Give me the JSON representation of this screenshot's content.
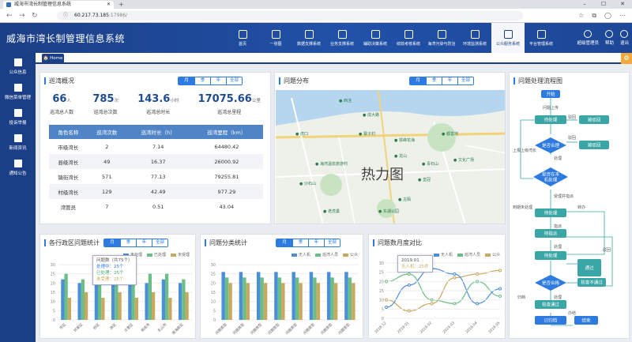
{
  "browser": {
    "tab_title": "威海市湾长制管理信息系统",
    "url_host": "60.217.73.185",
    "url_rest": ":17986/"
  },
  "app": {
    "title": "威海市湾长制管理信息系统"
  },
  "topnav": [
    {
      "label": "首页",
      "icon": "home-icon"
    },
    {
      "label": "一张图",
      "icon": "map-icon"
    },
    {
      "label": "数据支撑系统",
      "icon": "layers-icon"
    },
    {
      "label": "业务支撑系统",
      "icon": "database-icon"
    },
    {
      "label": "辅助决策系统",
      "icon": "bar-chart-icon"
    },
    {
      "label": "绩效考核系统",
      "icon": "medal-icon"
    },
    {
      "label": "海湾污染与防治",
      "icon": "shield-icon"
    },
    {
      "label": "环境监测系统",
      "icon": "gear-icon"
    },
    {
      "label": "公众服务系统",
      "icon": "car-icon",
      "active": true
    },
    {
      "label": "平台管理系统",
      "icon": "monitor-icon"
    }
  ],
  "user": {
    "name": "超级管理员",
    "help": "帮助",
    "logout": "退出"
  },
  "sidebar": [
    {
      "label": "公众信息"
    },
    {
      "label": "微信菜单管理"
    },
    {
      "label": "投诉举报"
    },
    {
      "label": "新闻资讯"
    },
    {
      "label": "通知公告"
    }
  ],
  "tabs": {
    "home": "Home"
  },
  "periods": [
    "月",
    "季",
    "年",
    "全部"
  ],
  "overview": {
    "title": "巡湾概况",
    "stats": [
      {
        "value": "66",
        "unit": "人",
        "label": "巡湾总人数"
      },
      {
        "value": "785",
        "unit": "次",
        "label": "巡湾总次数"
      },
      {
        "value": "143.6",
        "unit": "小时",
        "label": "巡湾总时长"
      },
      {
        "value": "17075.66",
        "unit": "公里",
        "label": "巡湾总里程"
      }
    ],
    "headers": [
      "角色名称",
      "巡湾次数",
      "巡湾时长（h）",
      "巡湾里程（km）"
    ],
    "rows": [
      [
        "市级湾长",
        "2",
        "7.14",
        "64480.42"
      ],
      [
        "县级湾长",
        "49",
        "16.37",
        "26000.92"
      ],
      [
        "镇街湾长",
        "571",
        "77.13",
        "79255.81"
      ],
      [
        "村级湾长",
        "129",
        "42.49",
        "977.29"
      ],
      [
        "湾管员",
        "7",
        "0.51",
        "43.04"
      ]
    ]
  },
  "map": {
    "title": "问题分布",
    "heat_label": "热力图",
    "labels": [
      "成大路",
      "虎口",
      "寨子村",
      "铁峰花海",
      "西洼",
      "都善地",
      "龙山",
      "青石山",
      "文化广场",
      "海湾温泉旅游村",
      "沙石山",
      "皇冠",
      "古陌",
      "东湖公园",
      "老虎巢"
    ]
  },
  "flow": {
    "title": "问题处理流程图",
    "nodes": {
      "start": "开始",
      "report": "问题上传",
      "pending1": "待处理",
      "reject1": "被驳回",
      "visible": "是否合理",
      "reject2": "被驳回",
      "inlocal": "是否在本机处理",
      "pending2": "待处理",
      "assign": "待指派",
      "pending3": "待处理",
      "resolve": "是否合格",
      "notpass": "核查不通过",
      "confirm": "核查通过",
      "done": "已归档",
      "end": "结束",
      "approve": "通过(待办仍为待处理)"
    },
    "edges": {
      "reject": "驳回",
      "handle": "处理",
      "up": "上报上级湾长",
      "assign": "受理并指派",
      "dispatch": "指派",
      "handle2": "处理",
      "record": "到期未处理",
      "transfer": "转办",
      "handle3": "处理",
      "archive": "归档",
      "done": "办结",
      "back": "驳回"
    }
  },
  "districts": {
    "title": "各行政区问题统计",
    "legend": [
      "未处理",
      "已处理",
      "未受理"
    ],
    "categories": [
      "市区",
      "环翠区",
      "经区",
      "高区",
      "文登区",
      "荣成市",
      "乳山市",
      "南海新区"
    ],
    "ticks": [
      "0",
      "5",
      "10",
      "15",
      "20",
      "25",
      "30"
    ],
    "tooltip": {
      "title": "问题数（共75个）",
      "l1": "处理中：25个",
      "l2": "已处理：25个",
      "l3": "未受理：25个"
    }
  },
  "categories": {
    "title": "问题分类统计",
    "legend": [
      "无人机",
      "巡湾人员",
      "公众"
    ],
    "categories": [
      "问题类型",
      "问题类型",
      "问题类型",
      "问题类型",
      "问题类型",
      "问题类型",
      "问题类型",
      "问题类型"
    ],
    "ticks": [
      "0",
      "5",
      "10",
      "15",
      "20",
      "25",
      "30"
    ]
  },
  "monthly": {
    "title": "问题数月度对比",
    "legend": [
      "无人机",
      "巡湾人员",
      "公众"
    ],
    "months": [
      "2018.12",
      "2019.01",
      "2019.02",
      "2019.03",
      "2019.04",
      "2019.05"
    ],
    "ticks": [
      "0",
      "5",
      "10",
      "15",
      "20",
      "25",
      "30"
    ],
    "tooltip": {
      "title": "2019.01",
      "line": "无人机：25件"
    }
  },
  "colors": {
    "blue": "#4a8fd8",
    "green": "#6bbf86",
    "gold": "#c9a860",
    "navy": "#1b3f86"
  },
  "chart_data": [
    {
      "type": "bar",
      "title": "各行政区问题统计",
      "categories": [
        "市区",
        "环翠区",
        "经区",
        "高区",
        "文登区",
        "荣成市",
        "乳山市",
        "南海新区"
      ],
      "ylim": [
        0,
        30
      ],
      "series": [
        {
          "name": "未处理",
          "values": [
            22,
            20,
            22,
            19,
            22,
            20,
            22,
            20
          ]
        },
        {
          "name": "已处理",
          "values": [
            25,
            22,
            25,
            22,
            25,
            25,
            25,
            22
          ]
        },
        {
          "name": "未受理",
          "values": [
            12,
            15,
            12,
            15,
            12,
            15,
            12,
            15
          ]
        }
      ]
    },
    {
      "type": "bar",
      "title": "问题分类统计",
      "categories": [
        "问题类型",
        "问题类型",
        "问题类型",
        "问题类型",
        "问题类型",
        "问题类型",
        "问题类型",
        "问题类型"
      ],
      "ylim": [
        0,
        30
      ],
      "series": [
        {
          "name": "无人机",
          "values": [
            26,
            26,
            26,
            26,
            26,
            26,
            26,
            26
          ]
        },
        {
          "name": "巡湾人员",
          "values": [
            23,
            23,
            23,
            23,
            23,
            23,
            23,
            23
          ]
        },
        {
          "name": "公众",
          "values": [
            20,
            20,
            20,
            20,
            20,
            20,
            20,
            20
          ]
        }
      ]
    },
    {
      "type": "line",
      "title": "问题数月度对比",
      "x": [
        "2018.12",
        "2019.01",
        "2019.02",
        "2019.03",
        "2019.04",
        "2019.05"
      ],
      "ylim": [
        0,
        30
      ],
      "series": [
        {
          "name": "无人机",
          "values": [
            6,
            18,
            27,
            24,
            8,
            16
          ]
        },
        {
          "name": "巡湾人员",
          "values": [
            20,
            24,
            10,
            8,
            20,
            12
          ]
        },
        {
          "name": "公众",
          "values": [
            10,
            4,
            8,
            22,
            24,
            26
          ]
        }
      ]
    }
  ]
}
